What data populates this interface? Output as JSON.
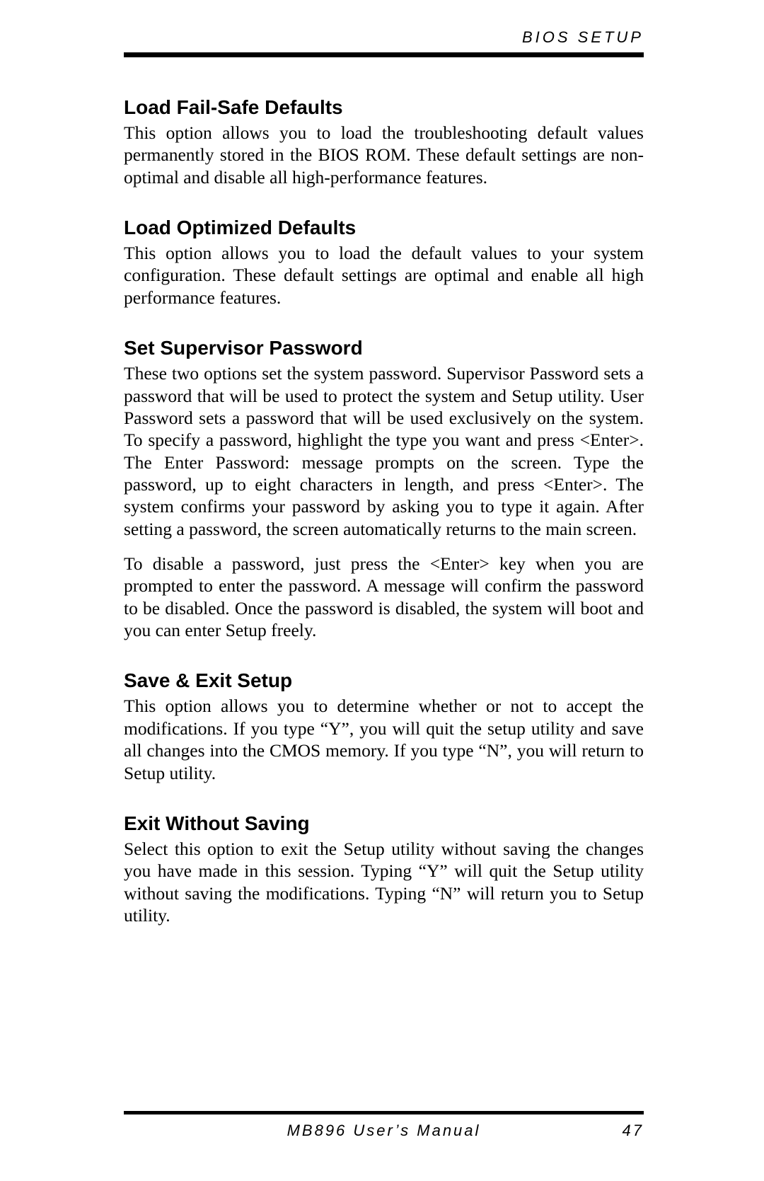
{
  "header": {
    "title": "BIOS SETUP"
  },
  "sections": [
    {
      "heading": "Load Fail-Safe Defaults",
      "paragraphs": [
        "This option allows you to load the troubleshooting default values permanently stored in the BIOS ROM. These default settings are non-optimal and disable all high-performance features."
      ]
    },
    {
      "heading": "Load Optimized Defaults",
      "paragraphs": [
        "This option allows you to load the default values to your system configuration. These default settings are optimal and enable all high performance features."
      ]
    },
    {
      "heading": "Set Supervisor Password",
      "paragraphs": [
        "These two options set the system password. Supervisor Password sets a password that will be used to protect the system and Setup utility. User Password sets a password that will be used exclusively on the system. To specify a password, highlight the type you want and press <Enter>. The Enter Password: message prompts on the screen. Type the password, up to eight characters in length, and press <Enter>. The system confirms your password by asking you to type it again. After setting a password, the screen automatically returns to the main screen.",
        "To disable a password, just press the <Enter> key when you are prompted to enter the password. A message will confirm the password to be disabled. Once the password is disabled, the system will boot and you can enter Setup freely."
      ]
    },
    {
      "heading": "Save & Exit Setup",
      "paragraphs": [
        "This option allows you to determine whether or not to accept the modifications. If you type “Y”, you will quit the setup utility and save all changes into the CMOS memory. If you type “N”, you will return to Setup utility."
      ]
    },
    {
      "heading": "Exit Without Saving",
      "paragraphs": [
        "Select this option to exit the Setup utility without saving the changes you have made in this session. Typing “Y” will quit the Setup utility without saving the modifications. Typing “N” will return you to Setup utility."
      ]
    }
  ],
  "footer": {
    "title": "MB896 User’s Manual",
    "page": "47"
  }
}
